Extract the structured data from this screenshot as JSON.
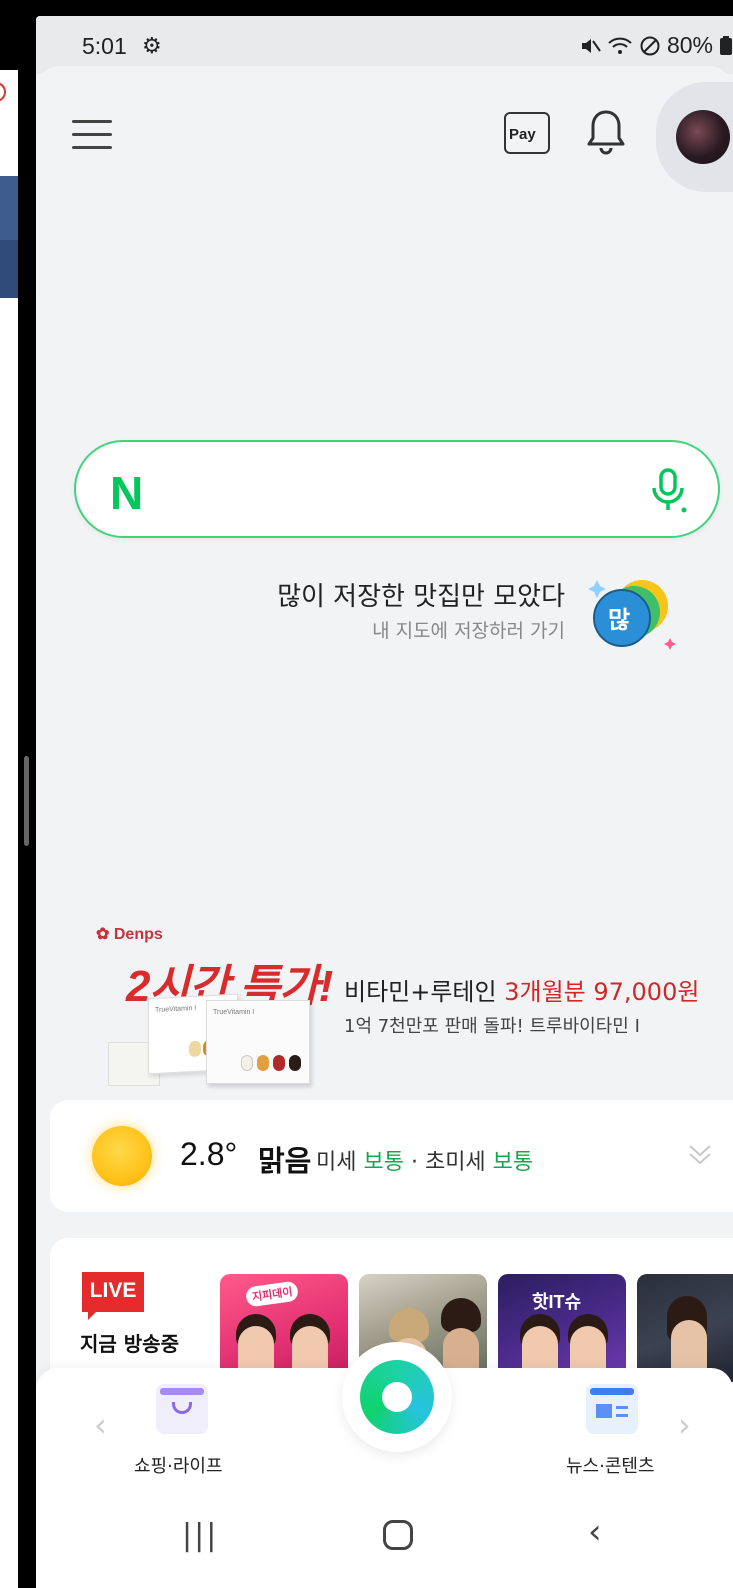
{
  "status": {
    "time": "5:01",
    "battery": "80%"
  },
  "header": {
    "pay_label": "Pay"
  },
  "search": {
    "logo": "N"
  },
  "promo": {
    "title": "많이 저장한 맛집만 모았다",
    "subtitle": "내 지도에 저장하러 가기",
    "badge_text": "많"
  },
  "ad": {
    "brand": "Denps",
    "headline": "2시간 특가!",
    "line1_prefix": "비타민+루테인 ",
    "line1_highlight": "3개월분 97,000원",
    "line2": "1억 7천만포 판매 돌파! 트루바이타민 I",
    "product_label": "TrueVitamin I"
  },
  "weather": {
    "temp": "2.8°",
    "condition": "맑음",
    "dust_label": "미세 ",
    "dust_value": "보통",
    "separator": " · 초미세 ",
    "ultrafine_value": "보통"
  },
  "live": {
    "badge": "LIVE",
    "label": "지금 방송중",
    "thumb1_caption": "지피데이",
    "thumb3_caption": "핫IT슈"
  },
  "bottom_nav": {
    "left_label": "쇼핑·라이프",
    "right_label": "뉴스·콘텐츠"
  },
  "colors": {
    "naver_green": "#03c75a",
    "search_border": "#3ed47a",
    "ad_red": "#d82b2b",
    "dust_green": "#19a54a"
  },
  "icons": [
    "menu-icon",
    "pay-icon",
    "bell-icon",
    "avatar",
    "mic-icon",
    "sun-icon",
    "chevron-down-icon",
    "shopping-icon",
    "news-icon",
    "green-dot-icon"
  ]
}
